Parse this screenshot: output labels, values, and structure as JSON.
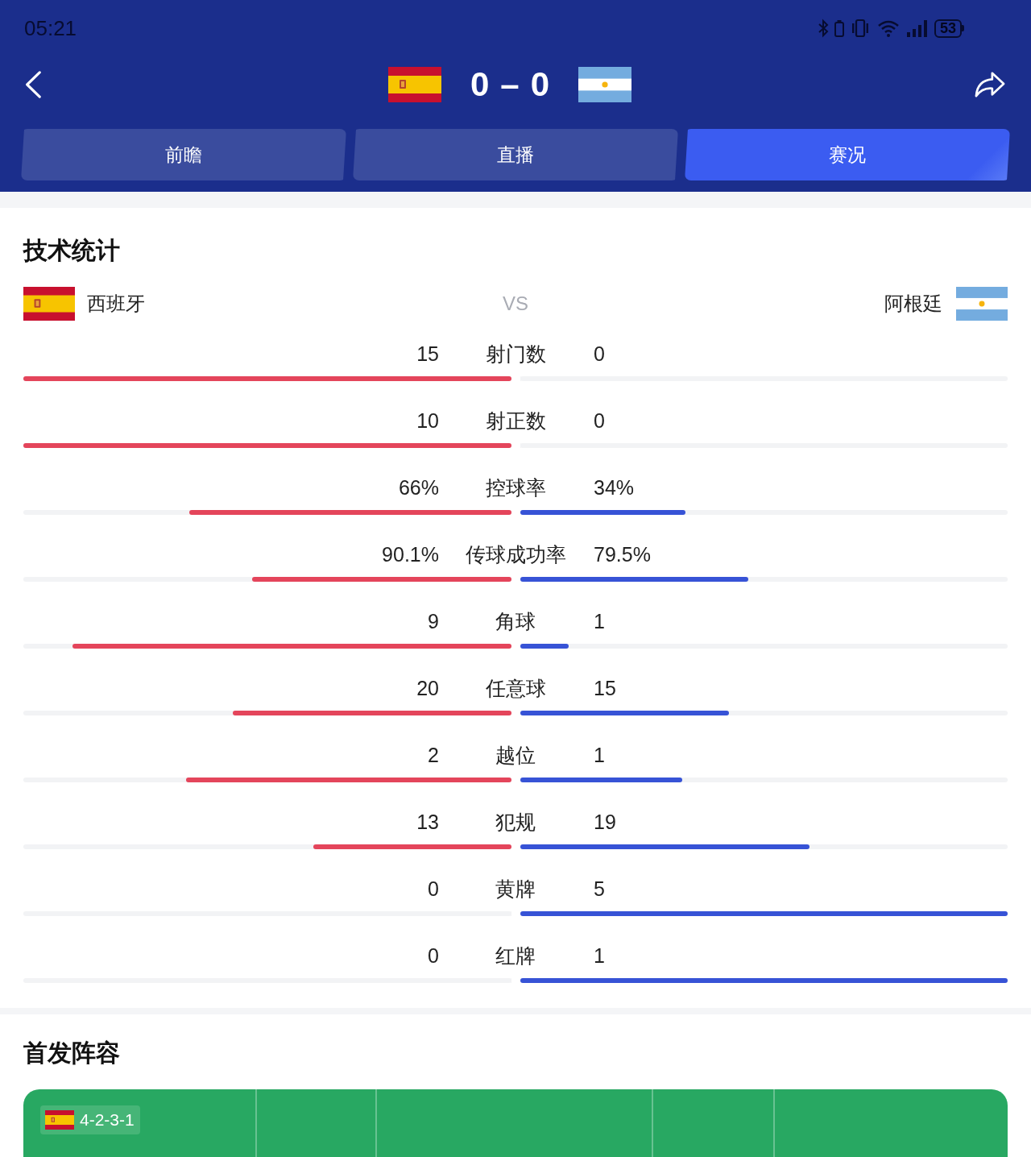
{
  "status_bar": {
    "time": "05:21",
    "battery": "53"
  },
  "match": {
    "home_score": "0",
    "separator": "–",
    "away_score": "0"
  },
  "tabs": [
    {
      "label": "前瞻",
      "selected": false
    },
    {
      "label": "直播",
      "selected": false
    },
    {
      "label": "赛况",
      "selected": true
    }
  ],
  "stats": {
    "title": "技术统计",
    "teams": [
      {
        "name": "西班牙"
      },
      {
        "name": "阿根廷"
      }
    ],
    "vs": "VS",
    "rows": [
      {
        "label": "射门数",
        "home": {
          "value": "15",
          "level": 1
        },
        "away": {
          "value": "0",
          "level": 0
        }
      },
      {
        "label": "射正数",
        "home": {
          "value": "10",
          "level": 1
        },
        "away": {
          "value": "0",
          "level": 0
        }
      },
      {
        "label": "控球率",
        "home": {
          "value": "66%",
          "level": 0.66
        },
        "away": {
          "value": "34%",
          "level": 0.34
        }
      },
      {
        "label": "传球成功率",
        "home": {
          "value": "90.1%",
          "level": 0.531
        },
        "away": {
          "value": "79.5%",
          "level": 0.469
        }
      },
      {
        "label": "角球",
        "home": {
          "value": "9",
          "level": 0.9
        },
        "away": {
          "value": "1",
          "level": 0.1
        }
      },
      {
        "label": "任意球",
        "home": {
          "value": "20",
          "level": 0.571
        },
        "away": {
          "value": "15",
          "level": 0.429
        }
      },
      {
        "label": "越位",
        "home": {
          "value": "2",
          "level": 0.667
        },
        "away": {
          "value": "1",
          "level": 0.333
        }
      },
      {
        "label": "犯规",
        "home": {
          "value": "13",
          "level": 0.406
        },
        "away": {
          "value": "19",
          "level": 0.594
        }
      },
      {
        "label": "黄牌",
        "home": {
          "value": "0",
          "level": 0
        },
        "away": {
          "value": "5",
          "level": 1
        }
      },
      {
        "label": "红牌",
        "home": {
          "value": "0",
          "level": 0
        },
        "away": {
          "value": "1",
          "level": 1
        }
      }
    ]
  },
  "lineup": {
    "title": "首发阵容",
    "formation": "4-2-3-1"
  }
}
